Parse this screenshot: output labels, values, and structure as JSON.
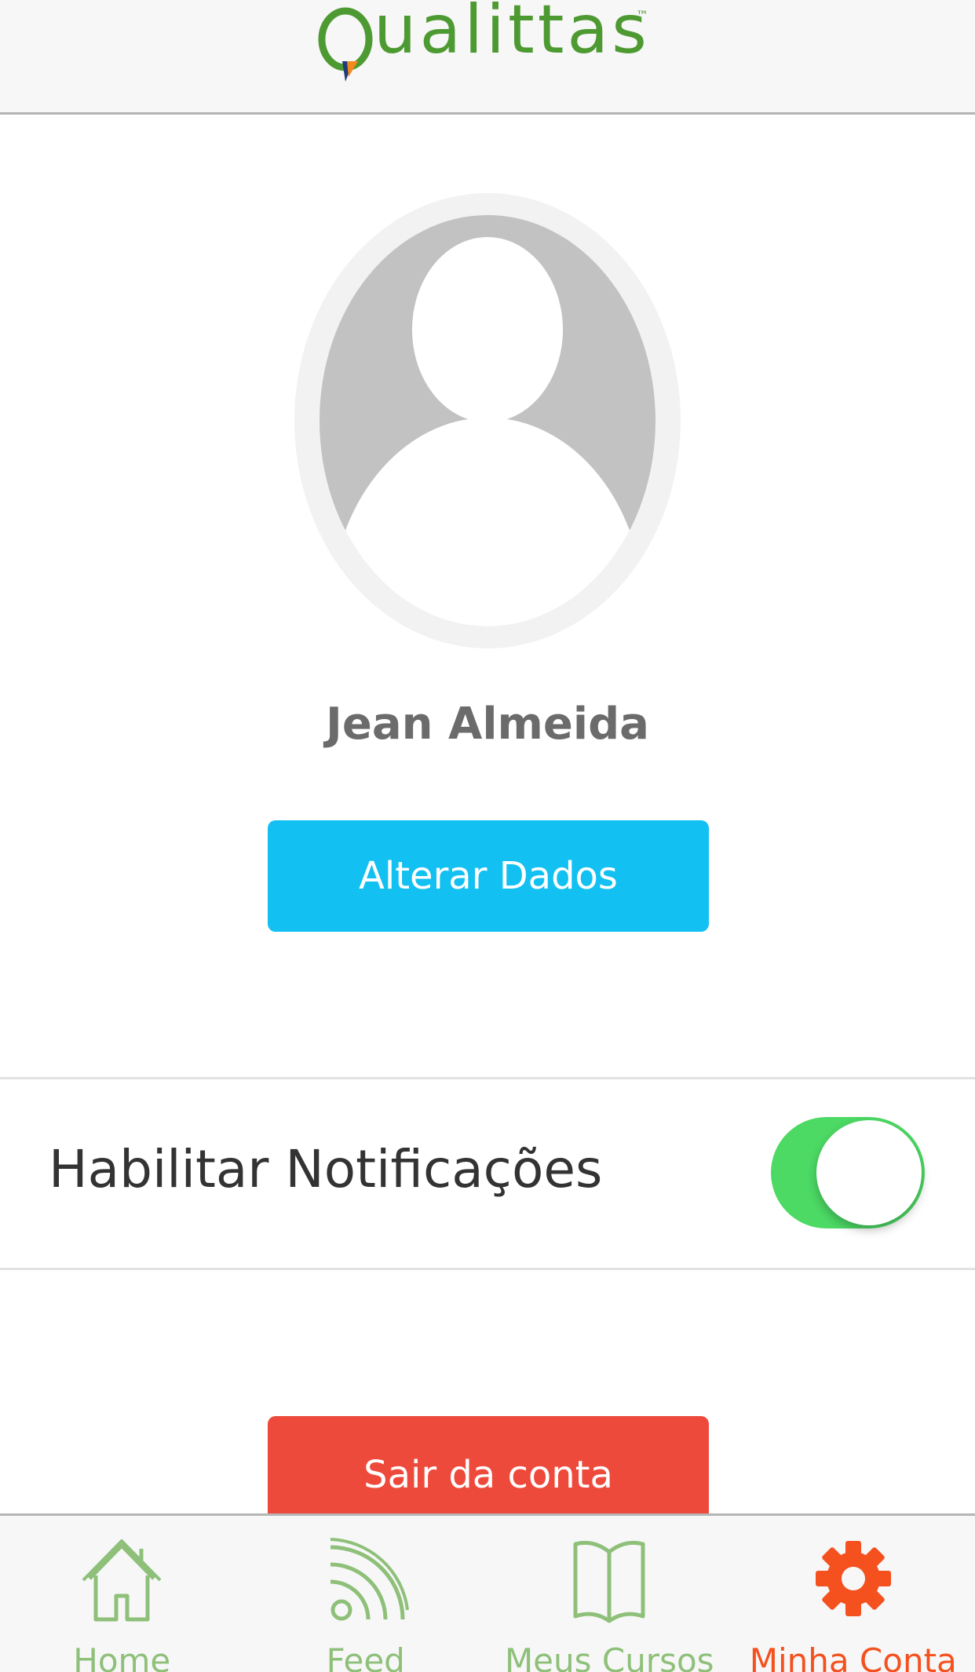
{
  "header": {
    "logo_text": "ualittas",
    "logo_tm": "™"
  },
  "profile": {
    "name": "Jean Almeida",
    "edit_button": "Alterar Dados"
  },
  "settings": {
    "notifications_label": "Habilitar Notificações",
    "notifications_enabled": true
  },
  "logout_button": "Sair da conta",
  "tabbar": {
    "tabs": [
      {
        "label": "Home",
        "icon": "home-icon",
        "active": false
      },
      {
        "label": "Feed",
        "icon": "rss-feed-icon",
        "active": false
      },
      {
        "label": "Meus Cursos",
        "icon": "book-icon",
        "active": false
      },
      {
        "label": "Minha Conta",
        "icon": "gear-icon",
        "active": true
      }
    ]
  },
  "colors": {
    "brand_green": "#4e9a32",
    "edit_button": "#12c1f1",
    "logout_button": "#ee4a3c",
    "toggle_on": "#4cd964",
    "tab_inactive": "#8ec07a",
    "tab_active": "#f4511e"
  }
}
